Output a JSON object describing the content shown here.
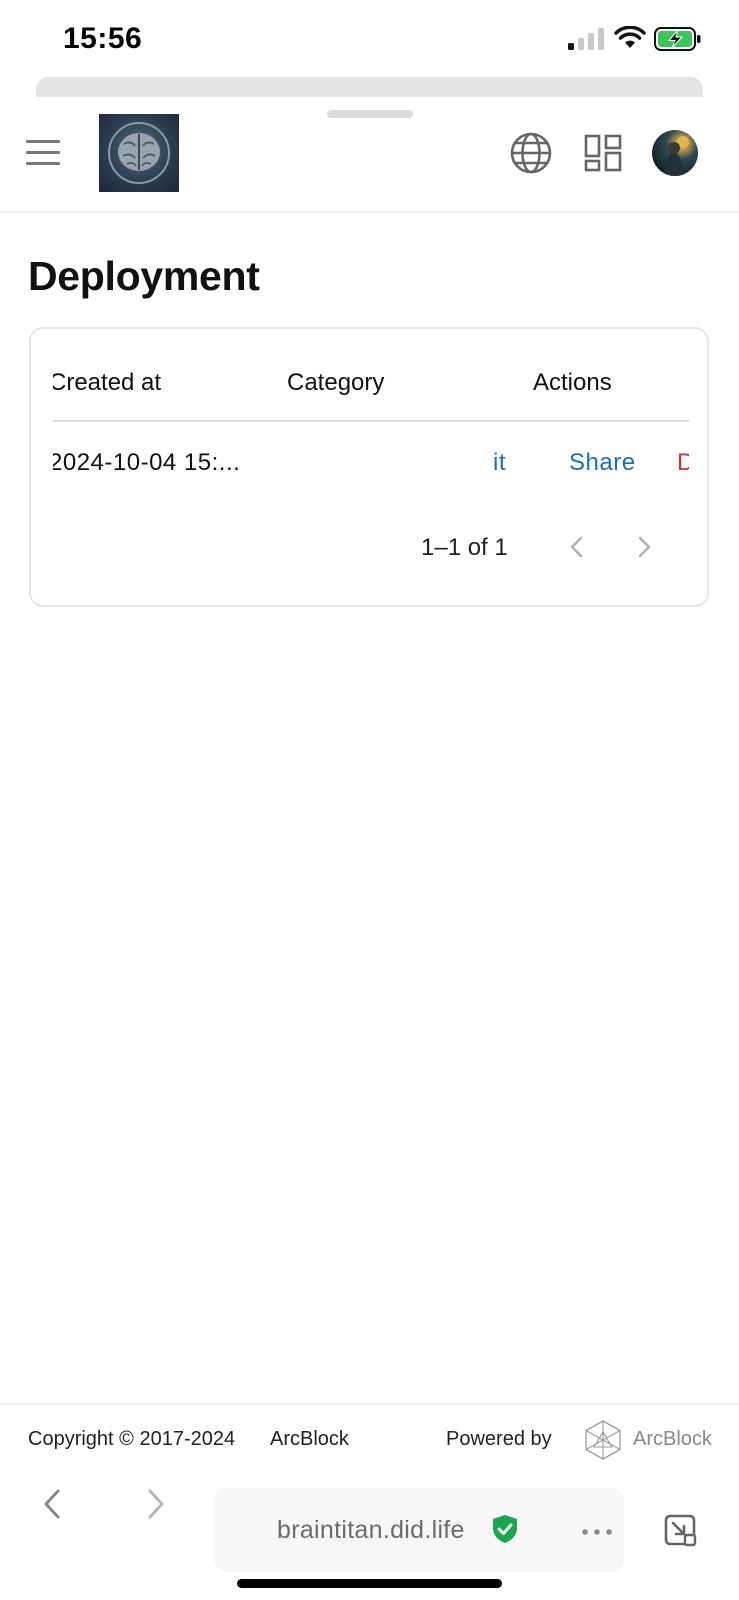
{
  "status_bar": {
    "time": "15:56",
    "icons": [
      "signal-icon",
      "wifi-icon",
      "battery-charging-icon"
    ]
  },
  "header": {
    "menu_icon": "menu-icon",
    "logo": "brain-logo",
    "actions": [
      "globe-icon",
      "apps-icon",
      "avatar"
    ]
  },
  "page": {
    "title": "Deployment"
  },
  "table": {
    "columns": [
      "Created at",
      "Category",
      "Actions"
    ],
    "rows": [
      {
        "created_at": "2024-10-04 15:...",
        "category": "",
        "actions": [
          "it",
          "Share",
          "De"
        ]
      }
    ],
    "pagination": {
      "range_text": "1–1 of 1"
    }
  },
  "footer": {
    "copyright": "Copyright © 2017-2024",
    "copyright_link": "ArcBlock",
    "powered_by": "Powered by",
    "brand": "ArcBlock"
  },
  "browser": {
    "url": "braintitan.did.life"
  },
  "colors": {
    "link_blue": "#1a6ec0",
    "danger_red": "#d32f2f",
    "secure_green": "#1aa64a"
  }
}
